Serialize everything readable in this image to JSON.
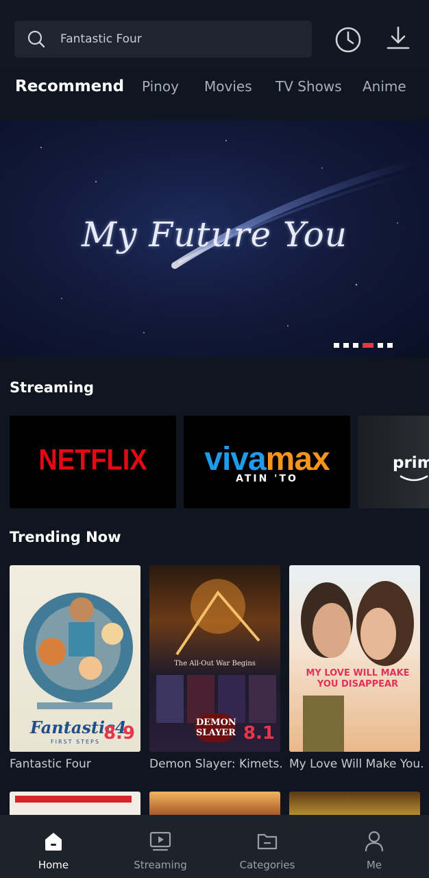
{
  "search": {
    "value": "Fantastic Four"
  },
  "header_icons": [
    "history-icon",
    "download-icon"
  ],
  "tabs": [
    "Recommend",
    "Pinoy",
    "Movies",
    "TV Shows",
    "Anime"
  ],
  "active_tab": "Recommend",
  "hero": {
    "title": "My Future You",
    "slide_count": 6,
    "active_slide": 4
  },
  "streaming": {
    "title": "Streaming",
    "providers": [
      {
        "name": "NETFLIX",
        "color": "#e50914"
      },
      {
        "name": "vivamax",
        "tagline": "ATIN 'TO",
        "colors": [
          "#1e9be9",
          "#f7941d"
        ]
      },
      {
        "name": "prim"
      }
    ]
  },
  "trending": {
    "title": "Trending Now",
    "items": [
      {
        "title": "Fantastic Four",
        "score": "8.9",
        "poster_text": "Fantastic4",
        "poster_sub": "FIRST STEPS"
      },
      {
        "title": "Demon Slayer: Kimets...",
        "score": "8.1",
        "poster_text": "The All-Out War Begins",
        "poster_sub": "DEMON SLAYER"
      },
      {
        "title": "My Love Will Make You...",
        "score": "",
        "poster_text": "MY LOVE WILL MAKE YOU DISAPPEAR"
      }
    ]
  },
  "bottom_nav": [
    {
      "label": "Home",
      "icon": "home-icon",
      "active": true
    },
    {
      "label": "Streaming",
      "icon": "play-screen-icon",
      "active": false
    },
    {
      "label": "Categories",
      "icon": "folder-icon",
      "active": false
    },
    {
      "label": "Me",
      "icon": "person-icon",
      "active": false
    }
  ],
  "colors": {
    "accent": "#e8354a",
    "background": "#0f1620",
    "nav_bg": "#1e232b"
  }
}
